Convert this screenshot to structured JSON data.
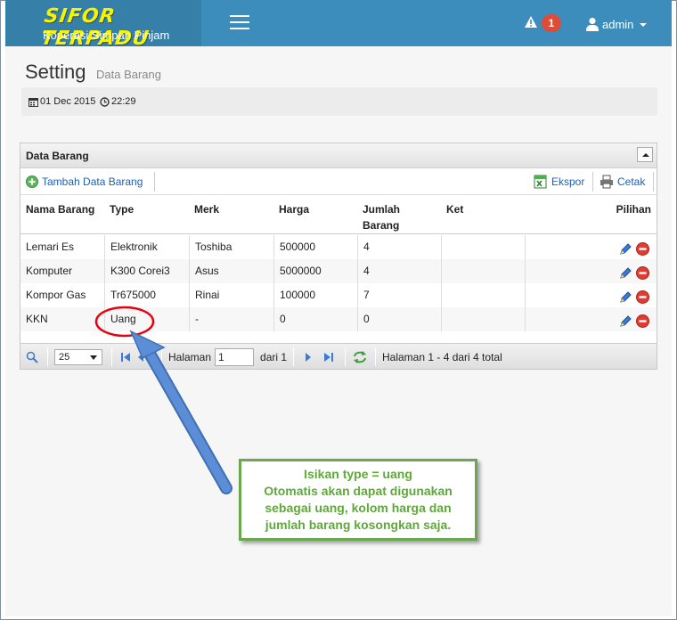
{
  "header": {
    "logo_title": "SIFOR TERPADU",
    "logo_subtitle": "Koperasi Simpan Pinjam",
    "alert_count": "1",
    "user_name": "admin"
  },
  "page": {
    "title": "Setting",
    "subtitle": "Data Barang",
    "date": "01 Dec 2015",
    "time": "22:29"
  },
  "panel": {
    "title": "Data Barang",
    "toolbar": {
      "add_label": "Tambah Data Barang",
      "export_label": "Ekspor",
      "print_label": "Cetak"
    },
    "columns": [
      "Nama Barang",
      "Type",
      "Merk",
      "Harga",
      "Jumlah Barang",
      "Ket",
      "Pilihan"
    ],
    "rows": [
      [
        "Lemari Es",
        "Elektronik",
        "Toshiba",
        "500000",
        "4",
        ""
      ],
      [
        "Komputer",
        "K300 Corei3",
        "Asus",
        "5000000",
        "4",
        ""
      ],
      [
        "Kompor Gas",
        "Tr675000",
        "Rinai",
        "100000",
        "7",
        ""
      ],
      [
        "KKN",
        "Uang",
        "-",
        "0",
        "0",
        ""
      ]
    ],
    "pager": {
      "page_size": "25",
      "page_label": "Halaman",
      "page_value": "1",
      "of_label": "dari 1",
      "info": "Halaman 1 - 4 dari 4 total"
    }
  },
  "annotation": {
    "line1": "Isikan type = uang",
    "line2": "Otomatis akan dapat digunakan",
    "line3": "sebagai uang, kolom harga dan",
    "line4": "jumlah barang kosongkan saja."
  },
  "colors": {
    "header_bg": "#3c8dbc",
    "logo_bg": "#367fa9",
    "logo_text": "#f6f200",
    "badge": "#dd4b39",
    "link": "#1f5fb6",
    "callout_border": "#6aa84f",
    "arrow": "#5b8ed6",
    "highlight_circle": "#e8000f"
  }
}
